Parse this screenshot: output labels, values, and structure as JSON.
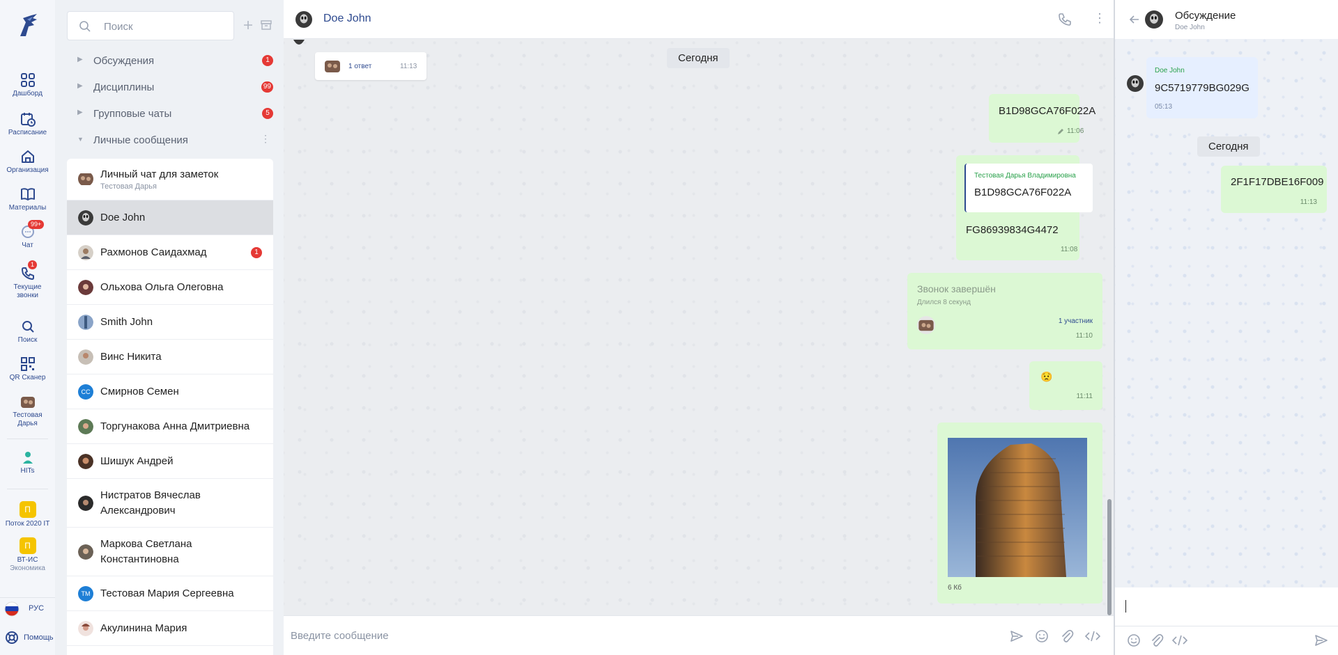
{
  "rail": {
    "items": [
      {
        "label": "Дашборд"
      },
      {
        "label": "Расписание"
      },
      {
        "label": "Организация"
      },
      {
        "label": "Материалы"
      },
      {
        "label": "Чат",
        "badge": "99+"
      },
      {
        "label1": "Текущие",
        "label2": "звонки",
        "badge": "1"
      },
      {
        "label": "Поиск"
      },
      {
        "label": "QR Сканер"
      },
      {
        "label1": "Тестовая",
        "label2": "Дарья"
      },
      {
        "label": "HITs"
      },
      {
        "letter": "П",
        "label": "Поток 2020 IT"
      },
      {
        "letter": "П",
        "label1": "ВТ-ИС",
        "label2": "Экономика"
      }
    ],
    "lang": "РУС",
    "help": "Помощь"
  },
  "sidebar": {
    "search_placeholder": "Поиск",
    "sections": [
      {
        "label": "Обсуждения",
        "count": "1"
      },
      {
        "label": "Дисциплины",
        "count": "99"
      },
      {
        "label": "Групповые чаты",
        "count": "5"
      },
      {
        "label": "Личные сообщения"
      }
    ],
    "chats": [
      {
        "name": "Личный чат для заметок",
        "sub": "Тестовая Дарья"
      },
      {
        "name": "Doe John"
      },
      {
        "name": "Рахмонов Саидахмад",
        "count": "1"
      },
      {
        "name": "Ольхова Ольга Олеговна"
      },
      {
        "name": "Smith John"
      },
      {
        "name": "Винс Никита"
      },
      {
        "name": "Смирнов Семен",
        "initials": "СС"
      },
      {
        "name": "Торгунакова Анна Дмитриевна"
      },
      {
        "name": "Шишук Андрей"
      },
      {
        "name1": "Нистратов Вячеслав",
        "name2": "Александрович"
      },
      {
        "name1": "Маркова Светлана",
        "name2": "Константиновна"
      },
      {
        "name": "Тестовая Мария Сергеевна",
        "initials": "ТМ"
      },
      {
        "name": "Акулинина Мария"
      }
    ]
  },
  "main": {
    "title": "Doe John",
    "thread_reply": {
      "label": "1 ответ",
      "time": "11:13"
    },
    "day": "Сегодня",
    "messages": [
      {
        "text": "B1D98GCA76F022A",
        "time": "11:06"
      },
      {
        "quote_author": "Тестовая Дарья Владимировна",
        "quote_text": "B1D98GCA76F022A",
        "text": "FG86939834G4472",
        "time": "11:08"
      },
      {
        "call_title": "Звонок завершён",
        "call_duration": "Длился 8 секунд",
        "participants": "1 участник",
        "time": "11:10"
      },
      {
        "emoji": "😟",
        "time": "11:11"
      },
      {
        "file_size": "6 Кб"
      }
    ],
    "input_placeholder": "Введите сообщение"
  },
  "thread": {
    "title": "Обсуждение",
    "subtitle": "Doe John",
    "root": {
      "author": "Doe John",
      "text": "9C5719779BG029G",
      "time": "05:13"
    },
    "day": "Сегодня",
    "reply": {
      "text": "2F1F17DBE16F009",
      "time": "11:13"
    }
  },
  "colors": {
    "accent": "#2e4a8f",
    "badge": "#e53935",
    "outgoing": "#dcf8d4",
    "quote_author": "#2aa14b"
  }
}
